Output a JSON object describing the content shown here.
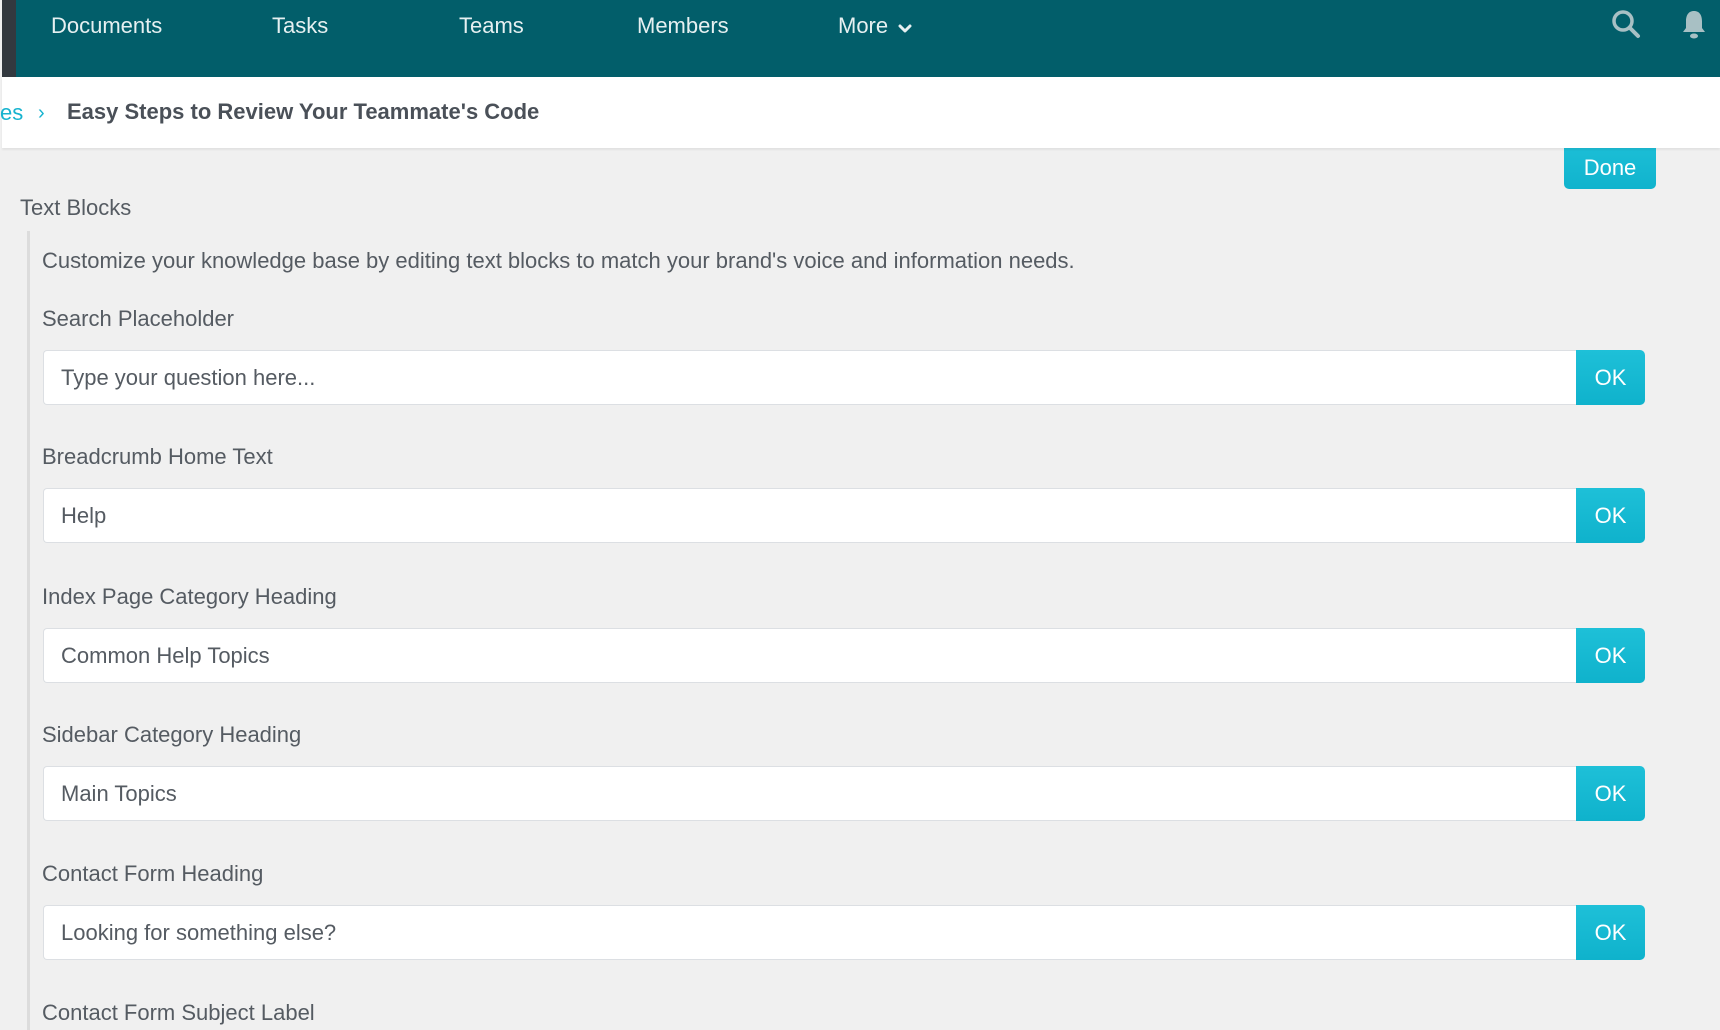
{
  "nav": {
    "items": [
      {
        "label": "Documents"
      },
      {
        "label": "Tasks"
      },
      {
        "label": "Teams"
      },
      {
        "label": "Members"
      },
      {
        "label": "More"
      }
    ],
    "more_icon": "chevron-down-icon",
    "search_icon": "search-icon",
    "bell_icon": "bell-icon",
    "background_color": "#025e6a"
  },
  "breadcrumb": {
    "parent_label": "es",
    "separator": "›",
    "current_title": "Easy Steps to Review Your Teammate's Code"
  },
  "toolbar": {
    "done_label": "Done"
  },
  "text_blocks": {
    "title": "Text Blocks",
    "description": "Customize your knowledge base by editing text blocks to match your brand's voice and information needs.",
    "fields": [
      {
        "label": "Search Placeholder",
        "value": "Type your question here...",
        "button": "OK"
      },
      {
        "label": "Breadcrumb Home Text",
        "value": "Help",
        "button": "OK"
      },
      {
        "label": "Index Page Category Heading",
        "value": "Common Help Topics",
        "button": "OK"
      },
      {
        "label": "Sidebar Category Heading",
        "value": "Main Topics",
        "button": "OK"
      },
      {
        "label": "Contact Form Heading",
        "value": "Looking for something else?",
        "button": "OK"
      },
      {
        "label": "Contact Form Subject Label"
      }
    ]
  },
  "colors": {
    "accent": "#17b3cf",
    "button": "#12b5ce",
    "page_background": "#f0f0f0"
  }
}
